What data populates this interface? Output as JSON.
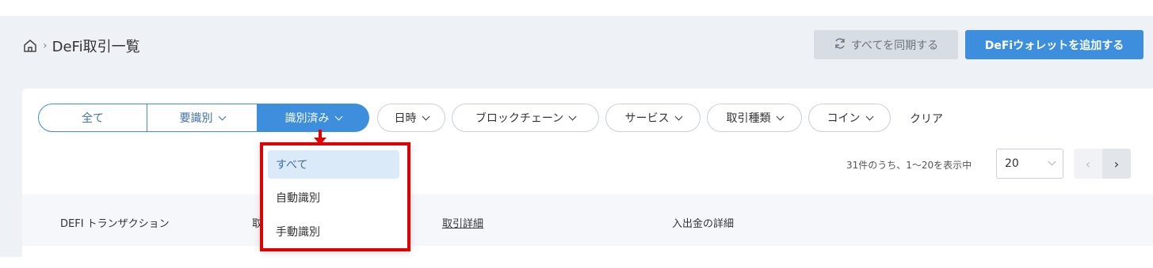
{
  "header": {
    "breadcrumb_sep": "›",
    "page_title": "DeFi取引一覧",
    "sync_label": "すべてを同期する",
    "add_wallet_label": "DeFiウォレットを追加する"
  },
  "segments": {
    "all": "全て",
    "needs_id": "要識別",
    "identified": "識別済み"
  },
  "filters": {
    "date": "日時",
    "blockchain": "ブロックチェーン",
    "service": "サービス",
    "tx_type": "取引種類",
    "coin": "コイン",
    "clear": "クリア"
  },
  "pagination": {
    "summary": "31件のうち、1〜20を表示中",
    "page_size": "20",
    "prev": "‹",
    "next": "›"
  },
  "table": {
    "col_defi_tx": "DEFI トランザクション",
    "col_partial": "取",
    "col_detail": "取引詳細",
    "col_inout": "入出金の詳細"
  },
  "dropdown": {
    "items": [
      "すべて",
      "自動識別",
      "手動識別"
    ]
  },
  "colors": {
    "accent": "#3d8fde",
    "annotation": "#e00000"
  }
}
